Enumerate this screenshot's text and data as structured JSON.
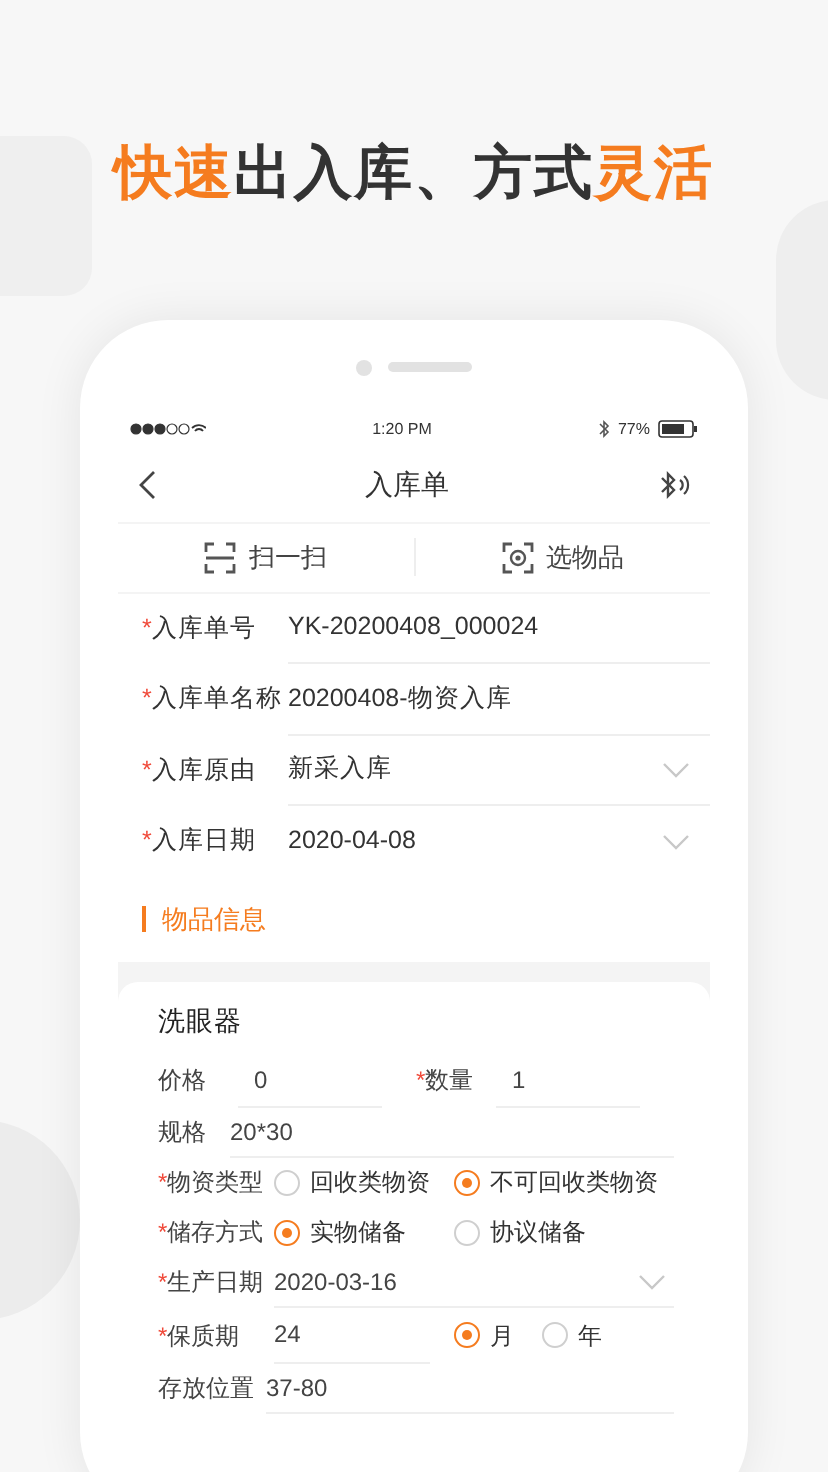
{
  "required_mark": "*",
  "headline": [
    {
      "text": "快速",
      "highlight": true
    },
    {
      "text": "出入库、方式",
      "highlight": false
    },
    {
      "text": "灵活",
      "highlight": true
    }
  ],
  "status_bar": {
    "time": "1:20 PM",
    "battery": "77%"
  },
  "nav": {
    "title": "入库单"
  },
  "actions": [
    {
      "label": "扫一扫",
      "kind": "scan"
    },
    {
      "label": "选物品",
      "kind": "pick"
    }
  ],
  "form": [
    {
      "label": "入库单号",
      "required": true,
      "value": "YK-20200408_000024",
      "kind": "text"
    },
    {
      "label": "入库单名称",
      "required": true,
      "value": "20200408-物资入库",
      "kind": "text"
    },
    {
      "label": "入库原由",
      "required": true,
      "value": "新采入库",
      "kind": "select"
    },
    {
      "label": "入库日期",
      "required": true,
      "value": "2020-04-08",
      "kind": "select"
    }
  ],
  "section": {
    "title": "物品信息"
  },
  "item": {
    "name": "洗眼器",
    "rows": [
      {
        "kind": "pair",
        "fields": [
          {
            "label": "价格",
            "required": false,
            "value": "0"
          },
          {
            "label": "数量",
            "required": true,
            "value": "1"
          }
        ]
      },
      {
        "kind": "text",
        "label": "规格",
        "required": false,
        "value": "20*30"
      },
      {
        "kind": "radio",
        "label": "物资类型",
        "required": true,
        "options": [
          {
            "label": "回收类物资",
            "selected": false
          },
          {
            "label": "不可回收类物资",
            "selected": true
          }
        ]
      },
      {
        "kind": "radio",
        "label": "储存方式",
        "required": true,
        "options": [
          {
            "label": "实物储备",
            "selected": true
          },
          {
            "label": "协议储备",
            "selected": false
          }
        ]
      },
      {
        "kind": "select",
        "label": "生产日期",
        "required": true,
        "value": "2020-03-16"
      },
      {
        "kind": "value_radio",
        "label": "保质期",
        "required": true,
        "value": "24",
        "options": [
          {
            "label": "月",
            "selected": true
          },
          {
            "label": "年",
            "selected": false
          }
        ]
      },
      {
        "kind": "text",
        "label": "存放位置",
        "required": false,
        "value": "37-80"
      }
    ]
  }
}
